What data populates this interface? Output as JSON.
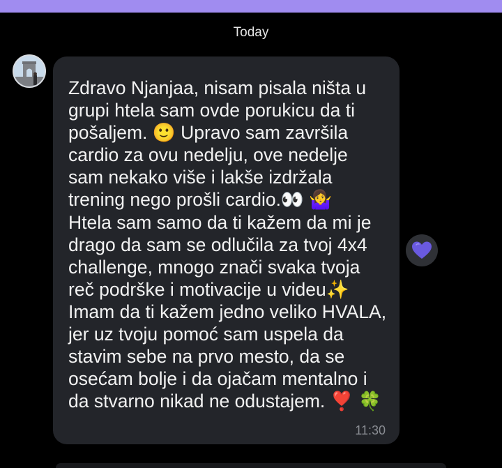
{
  "header": {
    "date_separator": "Today"
  },
  "message": {
    "sender_avatar": "avatar-arc-de-triomphe",
    "text": "Zdravo Njanjaa, nisam pisala ništa u\ngrupi htela sam ovde porukicu da ti\npošaljem. 🙂 Upravo sam završila\ncardio za ovu nedelju, ove nedelje\nsam nekako više i lakše izdržala\ntrening nego prošli cardio.👀 🤷‍♀️\nHtela sam samo da ti kažem da mi je\ndrago da sam se odlučila za tvoj 4x4\nchallenge, mnogo znači svaka tvoja\nreč podrške i motivacije u videu✨\nImam da ti kažem jedno veliko HVALA,\njer uz tvoju pomoć sam uspela da\nstavim sebe na prvo mesto, da se\nosećam bolje i da ojačam mentalno i\nda stvarno nikad ne odustajem. ❣️ 🍀",
    "time": "11:30"
  },
  "reaction": {
    "icon": "purple-heart-icon",
    "color": "#6a5ae0"
  },
  "theme": {
    "top_bar_color": "#a08cf0",
    "bubble_color": "#23252a",
    "background": "#000000"
  }
}
